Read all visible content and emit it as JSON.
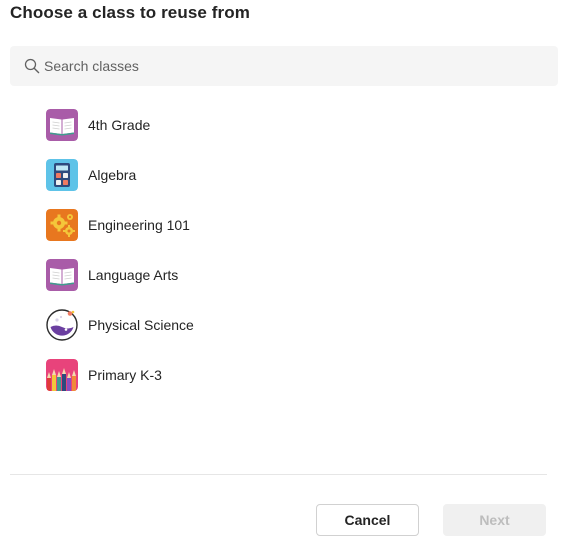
{
  "dialog": {
    "title": "Choose a class to reuse from"
  },
  "search": {
    "placeholder": "Search classes",
    "value": "",
    "icon": "search-icon"
  },
  "classes": [
    {
      "label": "4th Grade",
      "icon": "book-icon",
      "color": "#a95ca8"
    },
    {
      "label": "Algebra",
      "icon": "calculator-icon",
      "color": "#5ec3e8"
    },
    {
      "label": "Engineering 101",
      "icon": "gears-icon",
      "color": "#e8771f"
    },
    {
      "label": "Language Arts",
      "icon": "book-icon",
      "color": "#a95ca8"
    },
    {
      "label": "Physical Science",
      "icon": "flask-icon",
      "color": "#6b3fa0"
    },
    {
      "label": "Primary K-3",
      "icon": "pencils-icon",
      "color": "#e8437b"
    }
  ],
  "footer": {
    "cancel_label": "Cancel",
    "next_label": "Next",
    "next_enabled": false
  }
}
